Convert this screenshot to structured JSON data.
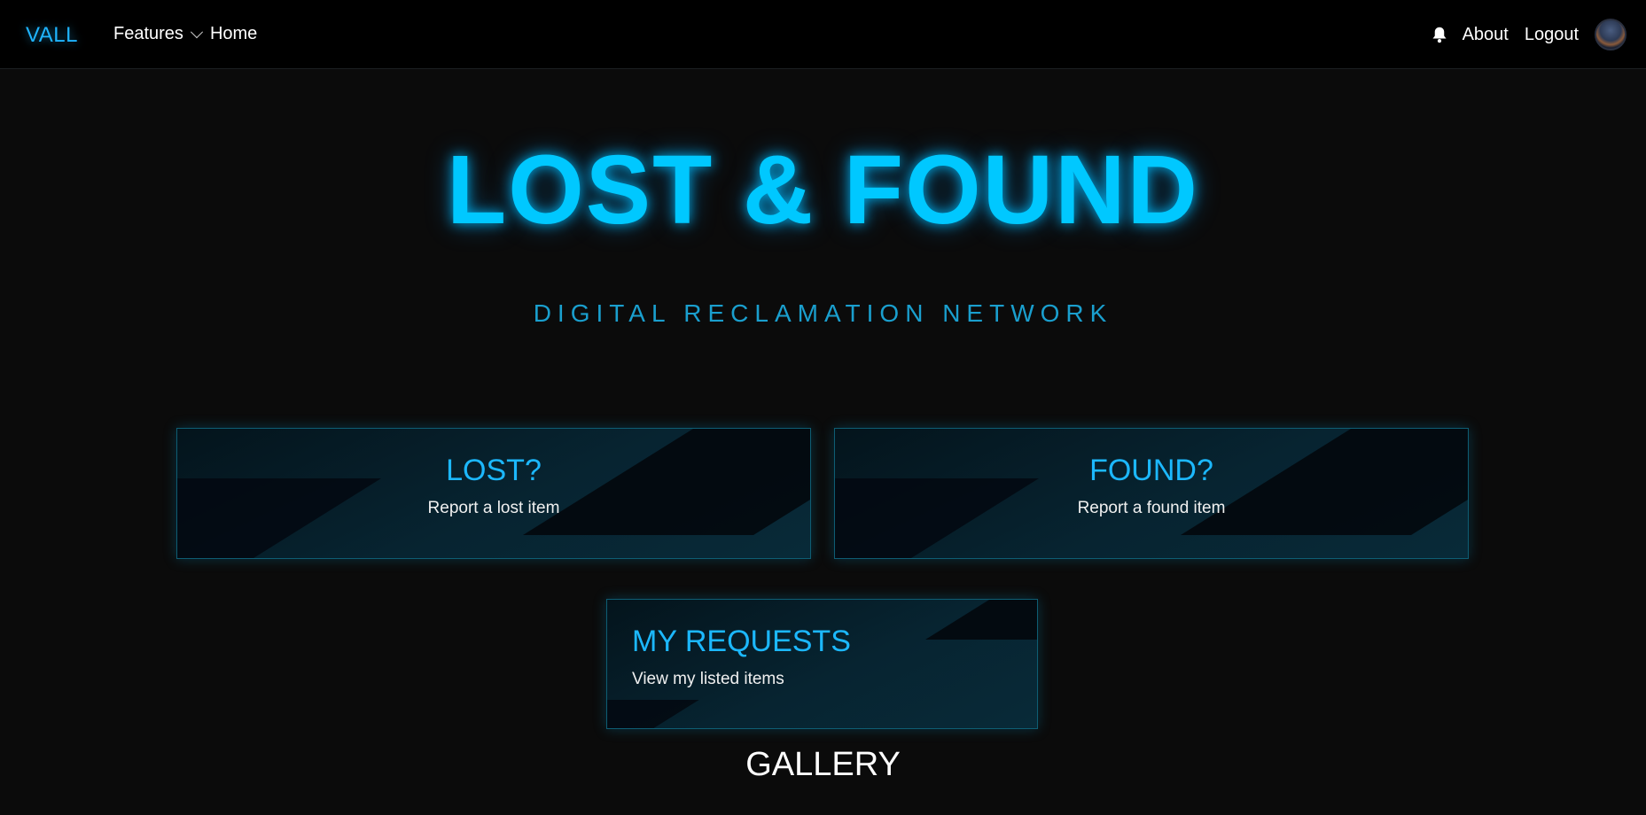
{
  "navbar": {
    "brand": "VALL",
    "features_label": "Features",
    "home_label": "Home",
    "about_label": "About",
    "logout_label": "Logout"
  },
  "hero": {
    "title": "LOST & FOUND",
    "subtitle": "DIGITAL RECLAMATION NETWORK"
  },
  "cards": {
    "lost": {
      "title": "LOST?",
      "description": "Report a lost item"
    },
    "found": {
      "title": "FOUND?",
      "description": "Report a found item"
    },
    "requests": {
      "title": "MY REQUESTS",
      "description": "View my listed items"
    }
  },
  "gallery": {
    "heading": "GALLERY"
  },
  "colors": {
    "accent": "#00c8ff",
    "subtitle": "#1a9fce",
    "background": "#0b0b0b",
    "navbar": "#000000"
  },
  "icons": {
    "notification": "bell-icon",
    "features_dropdown": "chevron-down-icon",
    "user": "avatar"
  }
}
